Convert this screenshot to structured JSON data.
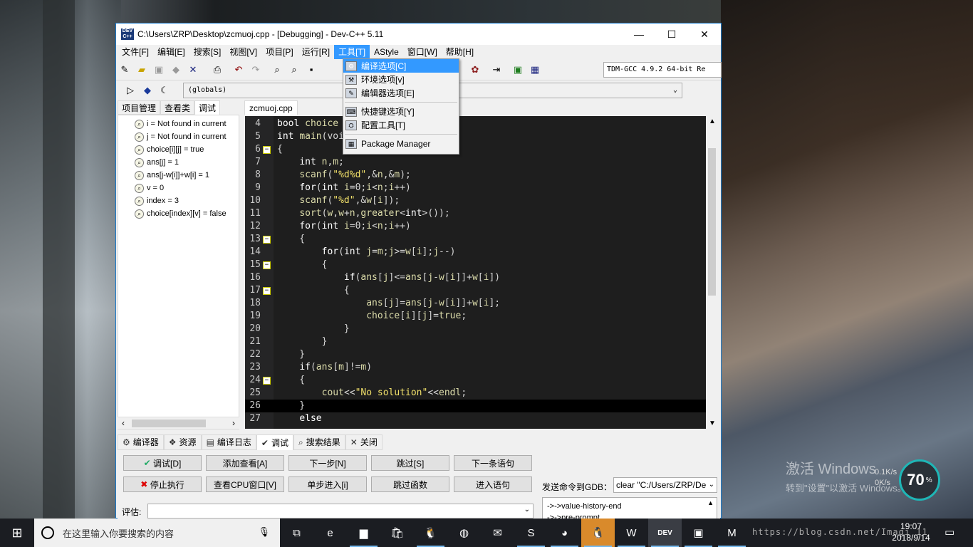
{
  "window": {
    "title": "C:\\Users\\ZRP\\Desktop\\zcmuoj.cpp - [Debugging] - Dev-C++ 5.11",
    "icon_text": "DEV\nC++",
    "controls": {
      "minimize": "—",
      "maximize": "☐",
      "close": "✕"
    }
  },
  "menubar": [
    "文件[F]",
    "编辑[E]",
    "搜索[S]",
    "视图[V]",
    "项目[P]",
    "运行[R]",
    "工具[T]",
    "AStyle",
    "窗口[W]",
    "帮助[H]"
  ],
  "active_menu_index": 6,
  "toolbar": {
    "compiler": "TDM-GCC 4.9.2 64-bit Re",
    "scope": "(globals)"
  },
  "tools_menu": {
    "items": [
      {
        "label": "编译选项[C]",
        "icon": "compiler-options-icon",
        "glyph": "⚙"
      },
      {
        "label": "环境选项[v]",
        "icon": "environment-options-icon",
        "glyph": "⚒"
      },
      {
        "label": "编辑器选项[E]",
        "icon": "editor-options-icon",
        "glyph": "✎"
      },
      {
        "label": "快捷键选项[Y]",
        "icon": "shortcut-options-icon",
        "glyph": "⌨"
      },
      {
        "label": "配置工具[T]",
        "icon": "configure-tools-icon",
        "glyph": "⛭"
      },
      {
        "label": "Package Manager",
        "icon": "package-manager-icon",
        "glyph": "▦"
      }
    ]
  },
  "left_panel": {
    "tabs": [
      "项目管理",
      "查看类",
      "调试"
    ],
    "selected_tab": 2,
    "watches": [
      "i = Not found in current",
      "j = Not found in current",
      "choice[i][j] = true",
      "ans[j] = 1",
      "ans[j-w[i]]+w[i] = 1",
      "v = 0",
      "index = 3",
      "choice[index][v] = false"
    ]
  },
  "editor": {
    "tab": "zcmuoj.cpp",
    "current_line": 26,
    "lines": [
      {
        "n": "4",
        "fold": "",
        "code": "bool choice"
      },
      {
        "n": "5",
        "fold": "",
        "code": "int main(voi"
      },
      {
        "n": "6",
        "fold": "−",
        "code": "{"
      },
      {
        "n": "7",
        "fold": "",
        "code": "    int n,m;"
      },
      {
        "n": "8",
        "fold": "",
        "code": "    scanf(\"%d%d\",&n,&m);"
      },
      {
        "n": "9",
        "fold": "",
        "code": "    for(int i=0;i<n;i++)"
      },
      {
        "n": "10",
        "fold": "",
        "code": "    scanf(\"%d\",&w[i]);"
      },
      {
        "n": "11",
        "fold": "",
        "code": "    sort(w,w+n,greater<int>());"
      },
      {
        "n": "12",
        "fold": "",
        "code": "    for(int i=0;i<n;i++)"
      },
      {
        "n": "13",
        "fold": "−",
        "code": "    {"
      },
      {
        "n": "14",
        "fold": "",
        "code": "        for(int j=m;j>=w[i];j--)"
      },
      {
        "n": "15",
        "fold": "−",
        "code": "        {"
      },
      {
        "n": "16",
        "fold": "",
        "code": "            if(ans[j]<=ans[j-w[i]]+w[i])"
      },
      {
        "n": "17",
        "fold": "−",
        "code": "            {"
      },
      {
        "n": "18",
        "fold": "",
        "code": "                ans[j]=ans[j-w[i]]+w[i];"
      },
      {
        "n": "19",
        "fold": "",
        "code": "                choice[i][j]=true;"
      },
      {
        "n": "20",
        "fold": "",
        "code": "            }"
      },
      {
        "n": "21",
        "fold": "",
        "code": "        }"
      },
      {
        "n": "22",
        "fold": "",
        "code": "    }"
      },
      {
        "n": "23",
        "fold": "",
        "code": "    if(ans[m]!=m)"
      },
      {
        "n": "24",
        "fold": "−",
        "code": "    {"
      },
      {
        "n": "25",
        "fold": "",
        "code": "        cout<<\"No solution\"<<endl;"
      },
      {
        "n": "26",
        "fold": "",
        "code": "    }"
      },
      {
        "n": "27",
        "fold": "",
        "code": "    else"
      }
    ]
  },
  "bottom_tabs": [
    {
      "label": "编译器",
      "icon": "compiler-tab-icon",
      "glyph": "⚙"
    },
    {
      "label": "资源",
      "icon": "resources-tab-icon",
      "glyph": "❖"
    },
    {
      "label": "编译日志",
      "icon": "compile-log-tab-icon",
      "glyph": "▤"
    },
    {
      "label": "调试",
      "icon": "debug-tab-icon",
      "glyph": "✔"
    },
    {
      "label": "搜索结果",
      "icon": "search-results-tab-icon",
      "glyph": "⌕"
    },
    {
      "label": "关闭",
      "icon": "close-tab-icon",
      "glyph": "✕"
    }
  ],
  "bottom_selected_tab": 3,
  "debug_buttons": {
    "debug": "调试[D]",
    "add_watch": "添加查看[A]",
    "next_step": "下一步[N]",
    "skip": "跳过[S]",
    "next_statement": "下一条语句",
    "stop": "停止执行",
    "cpu_window": "查看CPU窗口[V]",
    "step_into": "单步进入[i]",
    "skip_function": "跳过函数",
    "into_statement": "进入语句"
  },
  "debug_panel": {
    "eval_label": "评估:",
    "gdb_label": "发送命令到GDB：",
    "gdb_command": "clear \"C:/Users/ZRP/De",
    "gdb_output": [
      "->->value-history-end",
      "->->pre-prompt"
    ]
  },
  "desktop": {
    "watermark_title": "激活 Windows",
    "watermark_sub": "转到\"设置\"以激活 Windows。",
    "net_up": "0.1K/s",
    "net_down": "0K/s",
    "gauge_value": "70",
    "gauge_unit": "%"
  },
  "taskbar": {
    "search_placeholder": "在这里输入你要搜索的内容",
    "tray_text": "https://blog.csdn.net/Imagi 11",
    "time": "19:07",
    "date": "2018/9/14",
    "apps": [
      {
        "name": "task-view-icon",
        "glyph": "⧉"
      },
      {
        "name": "edge-icon",
        "glyph": "e"
      },
      {
        "name": "file-explorer-icon",
        "glyph": "▆"
      },
      {
        "name": "store-icon",
        "glyph": "🛍"
      },
      {
        "name": "qq-icon",
        "glyph": "🐧"
      },
      {
        "name": "browser-icon",
        "glyph": "◍"
      },
      {
        "name": "mail-icon",
        "glyph": "✉"
      },
      {
        "name": "wps-icon",
        "glyph": "S"
      },
      {
        "name": "firefox-icon",
        "glyph": "◕"
      },
      {
        "name": "qq-running-icon",
        "glyph": "🐧"
      },
      {
        "name": "wps-writer-icon",
        "glyph": "W"
      },
      {
        "name": "devcpp-icon",
        "glyph": "DEV"
      },
      {
        "name": "window-app-icon",
        "glyph": "▣"
      },
      {
        "name": "m-app-icon",
        "glyph": "M"
      }
    ]
  },
  "colors": {
    "accent": "#3399ff",
    "editor_bg": "#1e1e1e",
    "keyword": "#dcdcaa",
    "string": "#f1e06a",
    "taskbar": "#1b1d22"
  }
}
